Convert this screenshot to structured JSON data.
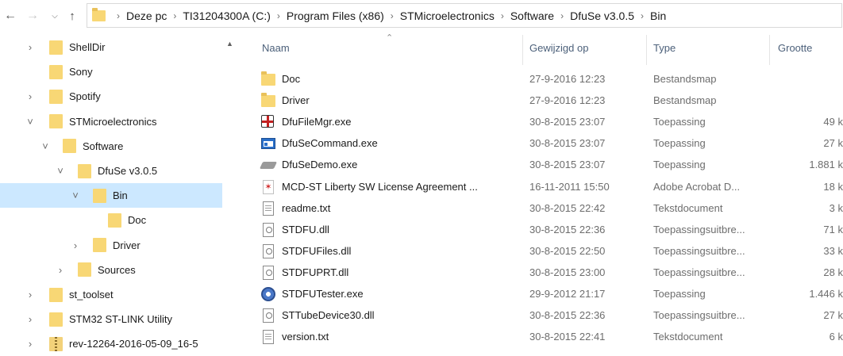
{
  "addressbar": {
    "breadcrumbs": [
      "Deze pc",
      "TI31204300A (C:)",
      "Program Files (x86)",
      "STMicroelectronics",
      "Software",
      "DfuSe v3.0.5",
      "Bin"
    ]
  },
  "tree": {
    "items": [
      {
        "label": "ShellDir",
        "chevron": "›",
        "indent": 0,
        "selected": false
      },
      {
        "label": "Sony",
        "chevron": "",
        "indent": 0,
        "selected": false
      },
      {
        "label": "Spotify",
        "chevron": "›",
        "indent": 0,
        "selected": false
      },
      {
        "label": "STMicroelectronics",
        "chevron": "˅",
        "indent": 0,
        "selected": false
      },
      {
        "label": "Software",
        "chevron": "˅",
        "indent": 1,
        "selected": false
      },
      {
        "label": "DfuSe v3.0.5",
        "chevron": "˅",
        "indent": 2,
        "selected": false
      },
      {
        "label": "Bin",
        "chevron": "˅",
        "indent": 3,
        "selected": true
      },
      {
        "label": "Doc",
        "chevron": "",
        "indent": 4,
        "selected": false
      },
      {
        "label": "Driver",
        "chevron": "›",
        "indent": 3,
        "selected": false
      },
      {
        "label": "Sources",
        "chevron": "›",
        "indent": 2,
        "selected": false
      },
      {
        "label": "st_toolset",
        "chevron": "›",
        "indent": 0,
        "selected": false
      },
      {
        "label": "STM32 ST-LINK Utility",
        "chevron": "›",
        "indent": 0,
        "selected": false
      },
      {
        "label": "rev-12264-2016-05-09_16-5",
        "chevron": "›",
        "indent": 0,
        "selected": false,
        "zip": true
      }
    ]
  },
  "list": {
    "columns": {
      "name": "Naam",
      "date": "Gewijzigd op",
      "type": "Type",
      "size": "Grootte"
    },
    "files": [
      {
        "name": "Doc",
        "date": "27-9-2016 12:23",
        "type": "Bestandsmap",
        "size": "",
        "icon": "folder-icon"
      },
      {
        "name": "Driver",
        "date": "27-9-2016 12:23",
        "type": "Bestandsmap",
        "size": "",
        "icon": "folder-icon"
      },
      {
        "name": "DfuFileMgr.exe",
        "date": "30-8-2015 23:07",
        "type": "Toepassing",
        "size": "49 k",
        "icon": "gift-app-icon"
      },
      {
        "name": "DfuSeCommand.exe",
        "date": "30-8-2015 23:07",
        "type": "Toepassing",
        "size": "27 k",
        "icon": "window-app-icon"
      },
      {
        "name": "DfuSeDemo.exe",
        "date": "30-8-2015 23:07",
        "type": "Toepassing",
        "size": "1.881 k",
        "icon": "chip-app-icon"
      },
      {
        "name": "MCD-ST Liberty SW License Agreement ...",
        "date": "16-11-2011 15:50",
        "type": "Adobe Acrobat D...",
        "size": "18 k",
        "icon": "pdf-icon"
      },
      {
        "name": "readme.txt",
        "date": "30-8-2015 22:42",
        "type": "Tekstdocument",
        "size": "3 k",
        "icon": "text-document-icon"
      },
      {
        "name": "STDFU.dll",
        "date": "30-8-2015 22:36",
        "type": "Toepassingsuitbre...",
        "size": "71 k",
        "icon": "dll-icon"
      },
      {
        "name": "STDFUFiles.dll",
        "date": "30-8-2015 22:50",
        "type": "Toepassingsuitbre...",
        "size": "33 k",
        "icon": "dll-icon"
      },
      {
        "name": "STDFUPRT.dll",
        "date": "30-8-2015 23:00",
        "type": "Toepassingsuitbre...",
        "size": "28 k",
        "icon": "dll-icon"
      },
      {
        "name": "STDFUTester.exe",
        "date": "29-9-2012 21:17",
        "type": "Toepassing",
        "size": "1.446 k",
        "icon": "gear-app-icon"
      },
      {
        "name": "STTubeDevice30.dll",
        "date": "30-8-2015 22:36",
        "type": "Toepassingsuitbre...",
        "size": "27 k",
        "icon": "dll-icon"
      },
      {
        "name": "version.txt",
        "date": "30-8-2015 22:41",
        "type": "Tekstdocument",
        "size": "6 k",
        "icon": "text-document-icon"
      }
    ]
  }
}
